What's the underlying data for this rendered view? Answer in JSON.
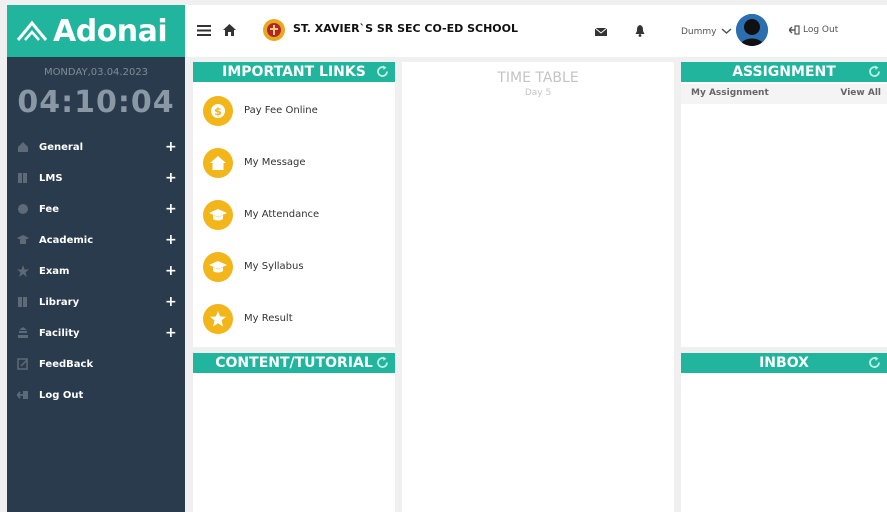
{
  "sidebar": {
    "logo_text": "Adonai",
    "date": "MONDAY,03.04.2023",
    "clock": "04:10:04",
    "items": [
      {
        "label": "General",
        "icon": "home-icon",
        "has_plus": true
      },
      {
        "label": "LMS",
        "icon": "book-icon",
        "has_plus": true
      },
      {
        "label": "Fee",
        "icon": "money-icon",
        "has_plus": true
      },
      {
        "label": "Academic",
        "icon": "graduation-icon",
        "has_plus": true
      },
      {
        "label": "Exam",
        "icon": "star-icon",
        "has_plus": true
      },
      {
        "label": "Library",
        "icon": "book-icon",
        "has_plus": true
      },
      {
        "label": "Facility",
        "icon": "building-icon",
        "has_plus": true
      },
      {
        "label": "FeedBack",
        "icon": "edit-icon",
        "has_plus": false
      },
      {
        "label": "Log Out",
        "icon": "logout-icon",
        "has_plus": false
      }
    ],
    "plus": "+"
  },
  "topbar": {
    "school_name": "ST. XAVIER`S SR SEC CO-ED SCHOOL",
    "user_name": "Dummy",
    "logout": "Log Out"
  },
  "panels": {
    "important_links": {
      "title": "IMPORTANT LINKS",
      "links": [
        {
          "label": "Pay Fee Online",
          "icon": "money-icon"
        },
        {
          "label": "My Message",
          "icon": "home-icon"
        },
        {
          "label": "My Attendance",
          "icon": "graduation-cap-icon"
        },
        {
          "label": "My Syllabus",
          "icon": "graduation-cap-icon"
        },
        {
          "label": "My Result",
          "icon": "star-icon"
        }
      ]
    },
    "content_tutorial": {
      "title": "CONTENT/TUTORIAL"
    },
    "timetable": {
      "title": "TIME TABLE",
      "day": "Day 5"
    },
    "assignment": {
      "title": "ASSIGNMENT",
      "my_assignment": "My Assignment",
      "view_all": "View All"
    },
    "inbox": {
      "title": "INBOX"
    }
  },
  "colors": {
    "accent": "#20b59c",
    "sidebar": "#2a3b4d",
    "link_icon": "#f2b51a"
  }
}
